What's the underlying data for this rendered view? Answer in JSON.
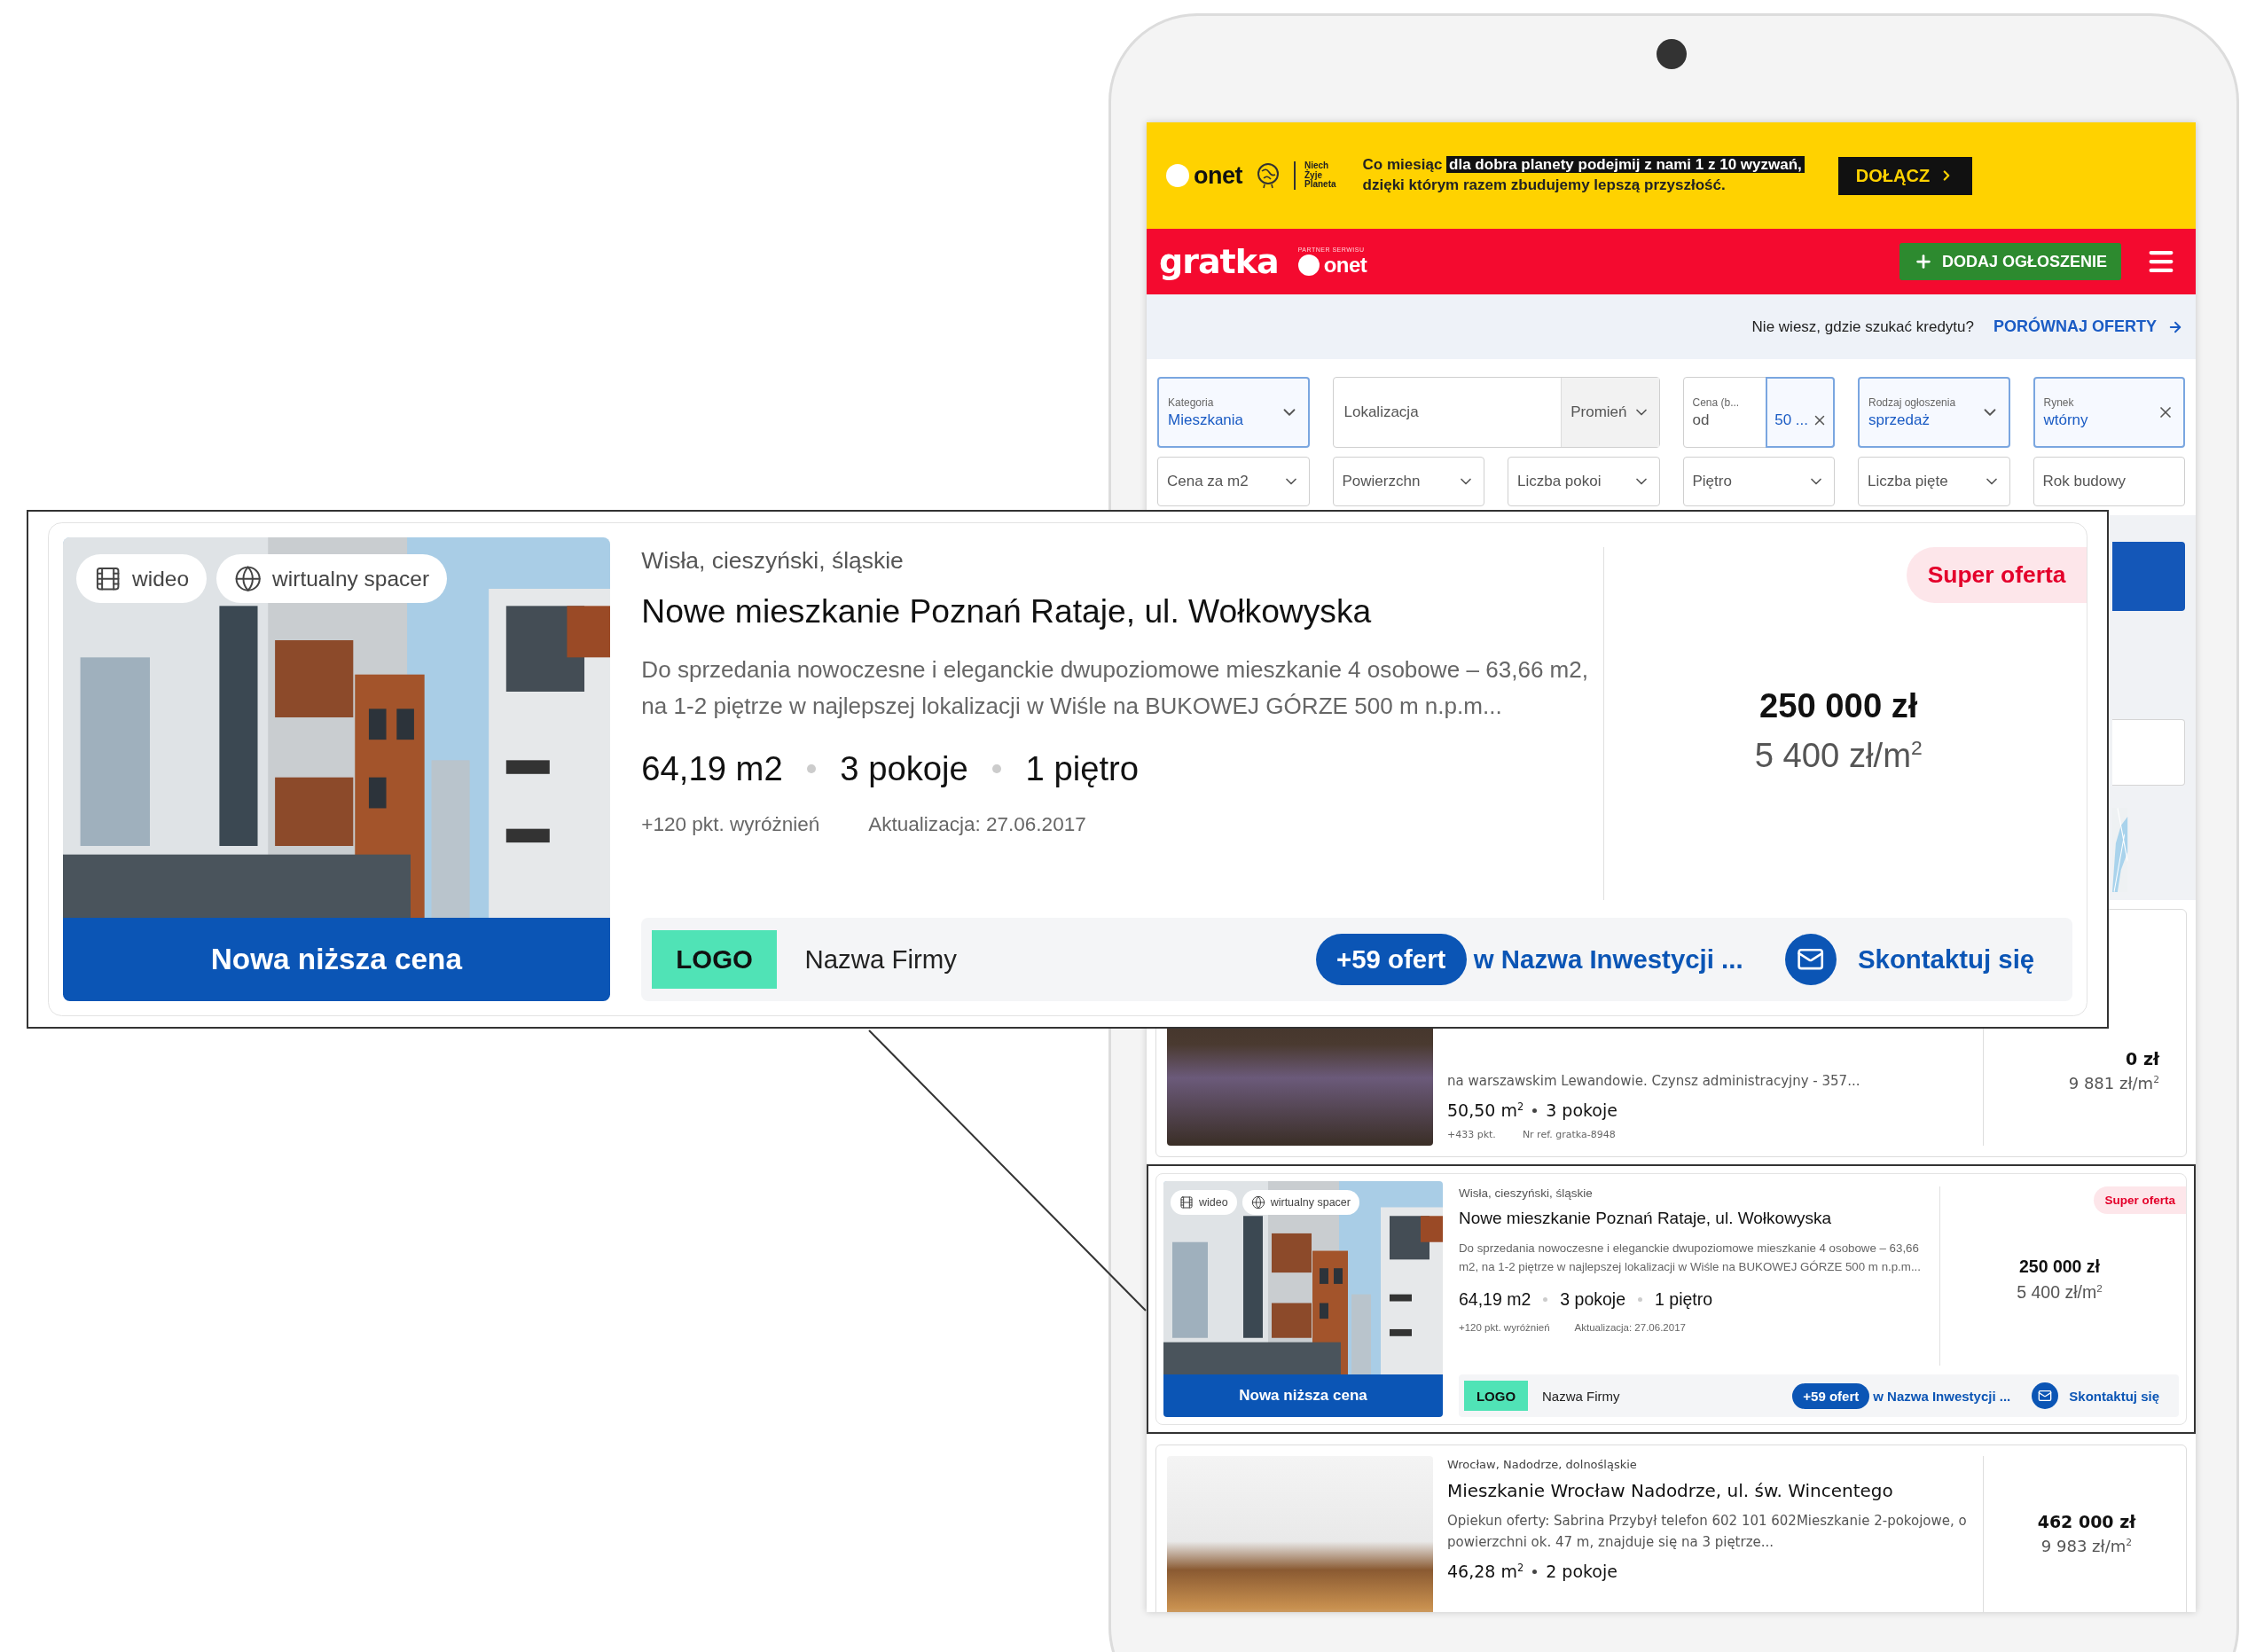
{
  "banner": {
    "brand": "onet",
    "partner_lines": [
      "Niech",
      "Żyje",
      "Planeta"
    ],
    "message_start": "Co miesiąc",
    "message_highlight": "dla dobra planety podejmij z nami 1 z 10 wyzwań,",
    "message_end": "dzięki którym razem zbudujemy lepszą przyszłość.",
    "button": "DOŁĄCZ"
  },
  "header": {
    "logo": "gratka",
    "partner_caption": "PARTNER SERWISU",
    "partner_logo": "onet",
    "add_button": "DODAJ OGŁOSZENIE"
  },
  "credit_bar": {
    "question": "Nie wiesz, gdzie szukać kredytu?",
    "link": "PORÓWNAJ OFERTY"
  },
  "filters": [
    {
      "kind": "select",
      "label": "Kategoria",
      "value": "Mieszkania"
    },
    {
      "kind": "location",
      "placeholder": "Lokalizacja",
      "radius": "Promień"
    },
    {
      "kind": "range",
      "label": "Cena (b...",
      "placeholder": "od",
      "value": "50 ..."
    },
    {
      "kind": "select",
      "label": "Rodzaj ogłoszenia",
      "value": "sprzedaż"
    },
    {
      "kind": "clearable",
      "label": "Rynek",
      "value": "wtórny"
    },
    {
      "kind": "dropdown",
      "placeholder": "Cena za m2"
    },
    {
      "kind": "dropdown",
      "placeholder": "Powierzchn"
    },
    {
      "kind": "dropdown",
      "placeholder": "Liczba pokoi"
    },
    {
      "kind": "dropdown",
      "placeholder": "Piętro"
    },
    {
      "kind": "dropdown",
      "placeholder": "Liczba pięte"
    },
    {
      "kind": "input",
      "placeholder": "Rok budowy"
    }
  ],
  "listings": [
    {
      "kind": "classic",
      "description": "na warszawskim Lewandowie. Czynsz administracyjny - 357...",
      "area": "50,50 m$^{2}$",
      "rooms": "3 pokoje",
      "points": "+433 pkt.",
      "ref": "Nr ref. gratka-8948",
      "price": "0 zł",
      "price_per_m2": "9 881 zł/m$^{2}$"
    },
    {
      "kind": "featured",
      "badges": [
        {
          "kind": "video",
          "label": "wideo"
        },
        {
          "kind": "tour",
          "label": "wirtualny spacer"
        }
      ],
      "photo_caption": "Nowa niższa cena",
      "location": "Wisła, cieszyński, śląskie",
      "title": "Nowe mieszkanie Poznań Rataje, ul. Wołkowyska",
      "description": "Do sprzedania nowoczesne i eleganckie dwupoziomowe mieszkanie 4 osobowe – 63,66 m2, na 1-2 piętrze w najlepszej lokalizacji w Wiśle na BUKOWEJ GÓRZE 500 m n.p.m...",
      "specs": [
        "64,19 m2",
        "3 pokoje",
        "1 piętro"
      ],
      "points": "+120 pkt. wyróżnień",
      "updated": "Aktualizacja: 27.06.2017",
      "tag": "Super oferta",
      "price": "250 000 zł",
      "price_per_m2": "5 400 zł/m$^{2}$",
      "company_logo": "LOGO",
      "company": "Nazwa Firmy",
      "offers": "+59 ofert",
      "investment": "w Nazwa Inwestycji ...",
      "contact": "Skontaktuj się"
    },
    {
      "kind": "classic",
      "location": "Wrocław, Nadodrze, dolnośląskie",
      "title": "Mieszkanie Wrocław Nadodrze, ul. św. Wincentego",
      "description": "Opiekun oferty: Sabrina Przybył telefon 602 101 602Mieszkanie 2-pokojowe, o powierzchni ok. 47 m, znajduje się na 3 piętrze...",
      "area": "46,28 m$^{2}$",
      "rooms": "2 pokoje",
      "price": "462 000 zł",
      "price_per_m2": "9 983 zł/m$^{2}$"
    }
  ],
  "callout": {
    "listing": {
      "kind": "featured",
      "badges": [
        {
          "kind": "video",
          "label": "wideo"
        },
        {
          "kind": "tour",
          "label": "wirtualny spacer"
        }
      ],
      "photo_caption": "Nowa niższa cena",
      "location": "Wisła, cieszyński, śląskie",
      "title": "Nowe mieszkanie Poznań Rataje, ul. Wołkowyska",
      "description": "Do sprzedania nowoczesne i eleganckie dwupoziomowe mieszkanie 4 osobowe – 63,66 m2, na 1-2 piętrze w najlepszej lokalizacji w Wiśle na BUKOWEJ GÓRZE 500 m n.p.m...",
      "specs": [
        "64,19 m2",
        "3 pokoje",
        "1 piętro"
      ],
      "points": "+120 pkt. wyróżnień",
      "updated": "Aktualizacja: 27.06.2017",
      "tag": "Super oferta",
      "price": "250 000 zł",
      "price_per_m2": "5 400 zł/m$^{2}$",
      "company_logo": "LOGO",
      "company": "Nazwa Firmy",
      "offers": "+59 ofert",
      "investment": "w Nazwa Inwestycji ...",
      "contact": "Skontaktuj się"
    }
  }
}
